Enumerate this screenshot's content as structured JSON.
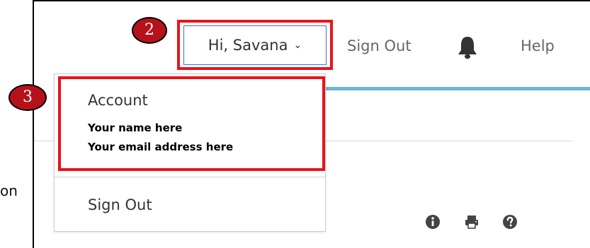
{
  "left_cutoff_text": "on",
  "header": {
    "greeting": "Hi, Savana",
    "greeting_chevron": "⌄",
    "sign_out": "Sign Out",
    "bell_icon": "bell-icon",
    "help": "Help"
  },
  "dropdown": {
    "account_title": "Account",
    "account_name": "Your name here",
    "account_email": "Your email address here",
    "sign_out": "Sign Out"
  },
  "annotations": {
    "step_2": "2",
    "step_3": "3",
    "highlight_color": "#e8141b",
    "badge_color": "#b5121b"
  },
  "toolbar_icons": [
    "info-icon",
    "print-icon",
    "question-icon"
  ],
  "colors": {
    "accent_bar": "#6bb6d6",
    "focus_border": "#3b6fd6"
  }
}
